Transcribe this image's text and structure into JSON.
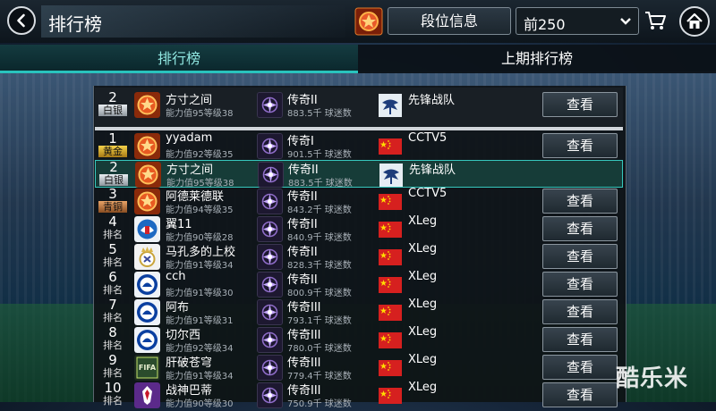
{
  "header": {
    "title": "排行榜",
    "rank_info_button": "段位信息",
    "range_select": {
      "selected": "前250"
    }
  },
  "tabs": [
    {
      "label": "排行榜",
      "active": true
    },
    {
      "label": "上期排行榜",
      "active": false
    }
  ],
  "colors": {
    "accent": "#29c3bd",
    "selected_row": "#163c38",
    "gold": "#f5d24a",
    "silver": "#d7dde2",
    "bronze": "#c77d45"
  },
  "my_rank": {
    "rank": "2",
    "rank_label": "白银",
    "rank_style": "silver",
    "avatar": "ranked-emblem",
    "name": "方寸之间",
    "stats": "能力值95等级38",
    "tier": "传奇II",
    "fans": "883.5千 球迷数",
    "club_icon": "dragon-crest",
    "club": "先锋战队",
    "view": "查看"
  },
  "rows": [
    {
      "rank": "1",
      "rank_label": "黄金",
      "rank_style": "gold",
      "avatar": "ranked-emblem",
      "name": "yyadam",
      "stats": "能力值92等级35",
      "tier": "传奇I",
      "fans": "901.5千 球迷数",
      "club_icon": "china-flag",
      "club": "CCTV5",
      "view": "查看"
    },
    {
      "rank": "2",
      "rank_label": "白银",
      "rank_style": "silver",
      "avatar": "ranked-emblem",
      "name": "方寸之间",
      "stats": "能力值95等级38",
      "tier": "传奇II",
      "fans": "883.5千 球迷数",
      "club_icon": "dragon-crest",
      "club": "先锋战队",
      "view": "",
      "selected": true
    },
    {
      "rank": "3",
      "rank_label": "青铜",
      "rank_style": "bronze",
      "avatar": "ranked-emblem",
      "name": "阿德莱德联",
      "stats": "能力值94等级35",
      "tier": "传奇II",
      "fans": "843.2千 球迷数",
      "club_icon": "china-flag",
      "club": "CCTV5",
      "view": "查看"
    },
    {
      "rank": "4",
      "rank_label": "排名",
      "rank_style": "plain",
      "avatar": "strasbourg-crest",
      "name": "翼11",
      "stats": "能力值90等级28",
      "tier": "传奇II",
      "fans": "840.9千 球迷数",
      "club_icon": "china-flag",
      "club": "XLeg",
      "view": "查看"
    },
    {
      "rank": "5",
      "rank_label": "排名",
      "rank_style": "plain",
      "avatar": "real-madrid-crest",
      "name": "马孔多的上校",
      "stats": "能力值91等级34",
      "tier": "传奇II",
      "fans": "828.3千 球迷数",
      "club_icon": "china-flag",
      "club": "XLeg",
      "view": "查看"
    },
    {
      "rank": "6",
      "rank_label": "排名",
      "rank_style": "plain",
      "avatar": "chelsea-crest",
      "name": "cch",
      "stats": "能力值91等级30",
      "tier": "传奇II",
      "fans": "800.9千 球迷数",
      "club_icon": "china-flag",
      "club": "XLeg",
      "view": "查看"
    },
    {
      "rank": "7",
      "rank_label": "排名",
      "rank_style": "plain",
      "avatar": "chelsea-crest",
      "name": "阿布",
      "stats": "能力值91等级31",
      "tier": "传奇III",
      "fans": "793.1千 球迷数",
      "club_icon": "china-flag",
      "club": "XLeg",
      "view": "查看"
    },
    {
      "rank": "8",
      "rank_label": "排名",
      "rank_style": "plain",
      "avatar": "chelsea-crest",
      "name": "切尔西",
      "stats": "能力值92等级34",
      "tier": "传奇III",
      "fans": "780.0千 球迷数",
      "club_icon": "china-flag",
      "club": "XLeg",
      "view": "查看"
    },
    {
      "rank": "9",
      "rank_label": "排名",
      "rank_style": "plain",
      "avatar": "fifa-badge",
      "avatar_text": "FIFA",
      "name": "肝破苍穹",
      "stats": "能力值91等级34",
      "tier": "传奇III",
      "fans": "779.4千 球迷数",
      "club_icon": "china-flag",
      "club": "XLeg",
      "view": "查看"
    },
    {
      "rank": "10",
      "rank_label": "排名",
      "rank_style": "plain",
      "avatar": "fiorentina-crest",
      "name": "战神巴蒂",
      "stats": "能力值90等级30",
      "tier": "传奇III",
      "fans": "750.9千 球迷数",
      "club_icon": "china-flag",
      "club": "XLeg",
      "view": "查看"
    }
  ],
  "watermark": "酷乐米"
}
